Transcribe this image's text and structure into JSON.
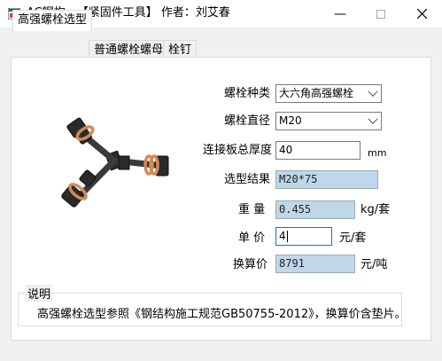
{
  "window": {
    "title": "AC钢构—【紧固件工具】 作者：刘艾春"
  },
  "tabs": [
    "高强螺栓选型",
    "普通螺栓螺母",
    "栓钉"
  ],
  "form": {
    "bolt_type_label": "螺栓种类",
    "bolt_type_value": "大六角高强螺栓",
    "diameter_label": "螺栓直径",
    "diameter_value": "M20",
    "thickness_label": "连接板总厚度",
    "thickness_value": "40",
    "thickness_unit": "mm",
    "result_label": "选型结果",
    "result_value": "M20*75",
    "weight_label": "重 量",
    "weight_value": "0.455",
    "weight_unit": "kg/套",
    "price_label": "单 价",
    "price_value": "4",
    "price_unit": "元/套",
    "converted_label": "换算价",
    "converted_value": "8791",
    "converted_unit": "元/吨"
  },
  "note": {
    "title": "说明",
    "text": "高强螺栓选型参照《钢结构施工规范GB50755-2012》，换算价含垫片。"
  },
  "icons": {
    "app": "app-icon",
    "minimize": "minimize-icon",
    "maximize": "maximize-icon",
    "close": "close-icon"
  }
}
